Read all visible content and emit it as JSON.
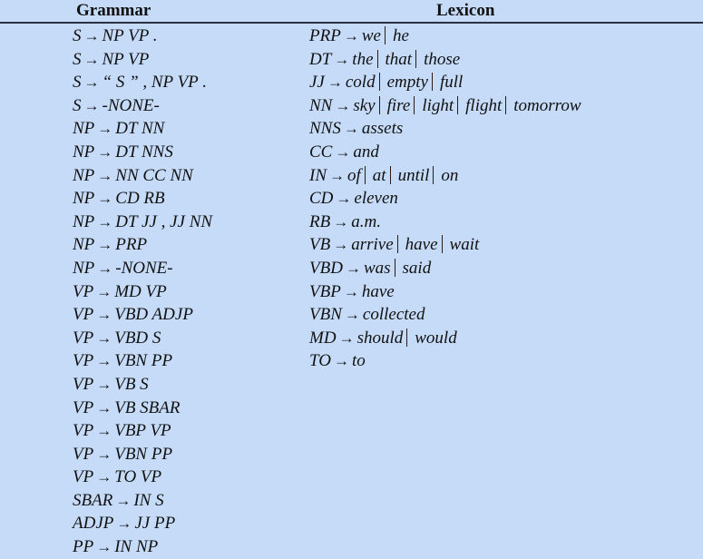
{
  "headers": {
    "grammar": "Grammar",
    "lexicon": "Lexicon"
  },
  "arrow_symbol": "→",
  "grammar": [
    {
      "lhs": "S",
      "rhs": "NP VP ."
    },
    {
      "lhs": "S",
      "rhs": "NP VP"
    },
    {
      "lhs": "S",
      "rhs": "“ S ” , NP VP ."
    },
    {
      "lhs": "S",
      "rhs": "-NONE-"
    },
    {
      "lhs": "NP",
      "rhs": "DT NN"
    },
    {
      "lhs": "NP",
      "rhs": "DT NNS"
    },
    {
      "lhs": "NP",
      "rhs": "NN CC NN"
    },
    {
      "lhs": "NP",
      "rhs": "CD RB"
    },
    {
      "lhs": "NP",
      "rhs": "DT JJ , JJ NN"
    },
    {
      "lhs": "NP",
      "rhs": "PRP"
    },
    {
      "lhs": "NP",
      "rhs": "-NONE-"
    },
    {
      "lhs": "VP",
      "rhs": "MD VP"
    },
    {
      "lhs": "VP",
      "rhs": "VBD ADJP"
    },
    {
      "lhs": "VP",
      "rhs": "VBD S"
    },
    {
      "lhs": "VP",
      "rhs": "VBN PP"
    },
    {
      "lhs": "VP",
      "rhs": "VB S"
    },
    {
      "lhs": "VP",
      "rhs": "VB SBAR"
    },
    {
      "lhs": "VP",
      "rhs": "VBP VP"
    },
    {
      "lhs": "VP",
      "rhs": "VBN PP"
    },
    {
      "lhs": "VP",
      "rhs": "TO VP"
    },
    {
      "lhs": "SBAR",
      "rhs": "IN S"
    },
    {
      "lhs": "ADJP",
      "rhs": "JJ PP"
    },
    {
      "lhs": "PP",
      "rhs": "IN NP"
    }
  ],
  "lexicon": [
    {
      "lhs": "PRP",
      "words": [
        "we",
        "he"
      ]
    },
    {
      "lhs": "DT",
      "words": [
        "the",
        "that",
        "those"
      ]
    },
    {
      "lhs": "JJ",
      "words": [
        "cold",
        "empty",
        "full"
      ]
    },
    {
      "lhs": "NN",
      "words": [
        "sky",
        "fire",
        "light",
        "flight",
        "tomorrow"
      ]
    },
    {
      "lhs": "NNS",
      "words": [
        "assets"
      ]
    },
    {
      "lhs": "CC",
      "words": [
        "and"
      ]
    },
    {
      "lhs": "IN",
      "words": [
        "of",
        "at",
        "until",
        "on"
      ]
    },
    {
      "lhs": "CD",
      "words": [
        "eleven"
      ]
    },
    {
      "lhs": "RB",
      "words": [
        "a.m."
      ]
    },
    {
      "lhs": "VB",
      "words": [
        "arrive",
        "have",
        "wait"
      ]
    },
    {
      "lhs": "VBD",
      "words": [
        "was",
        "said"
      ]
    },
    {
      "lhs": "VBP",
      "words": [
        "have"
      ]
    },
    {
      "lhs": "VBN",
      "words": [
        "collected"
      ]
    },
    {
      "lhs": "MD",
      "words": [
        "should",
        "would"
      ]
    },
    {
      "lhs": "TO",
      "words": [
        "to"
      ]
    }
  ]
}
